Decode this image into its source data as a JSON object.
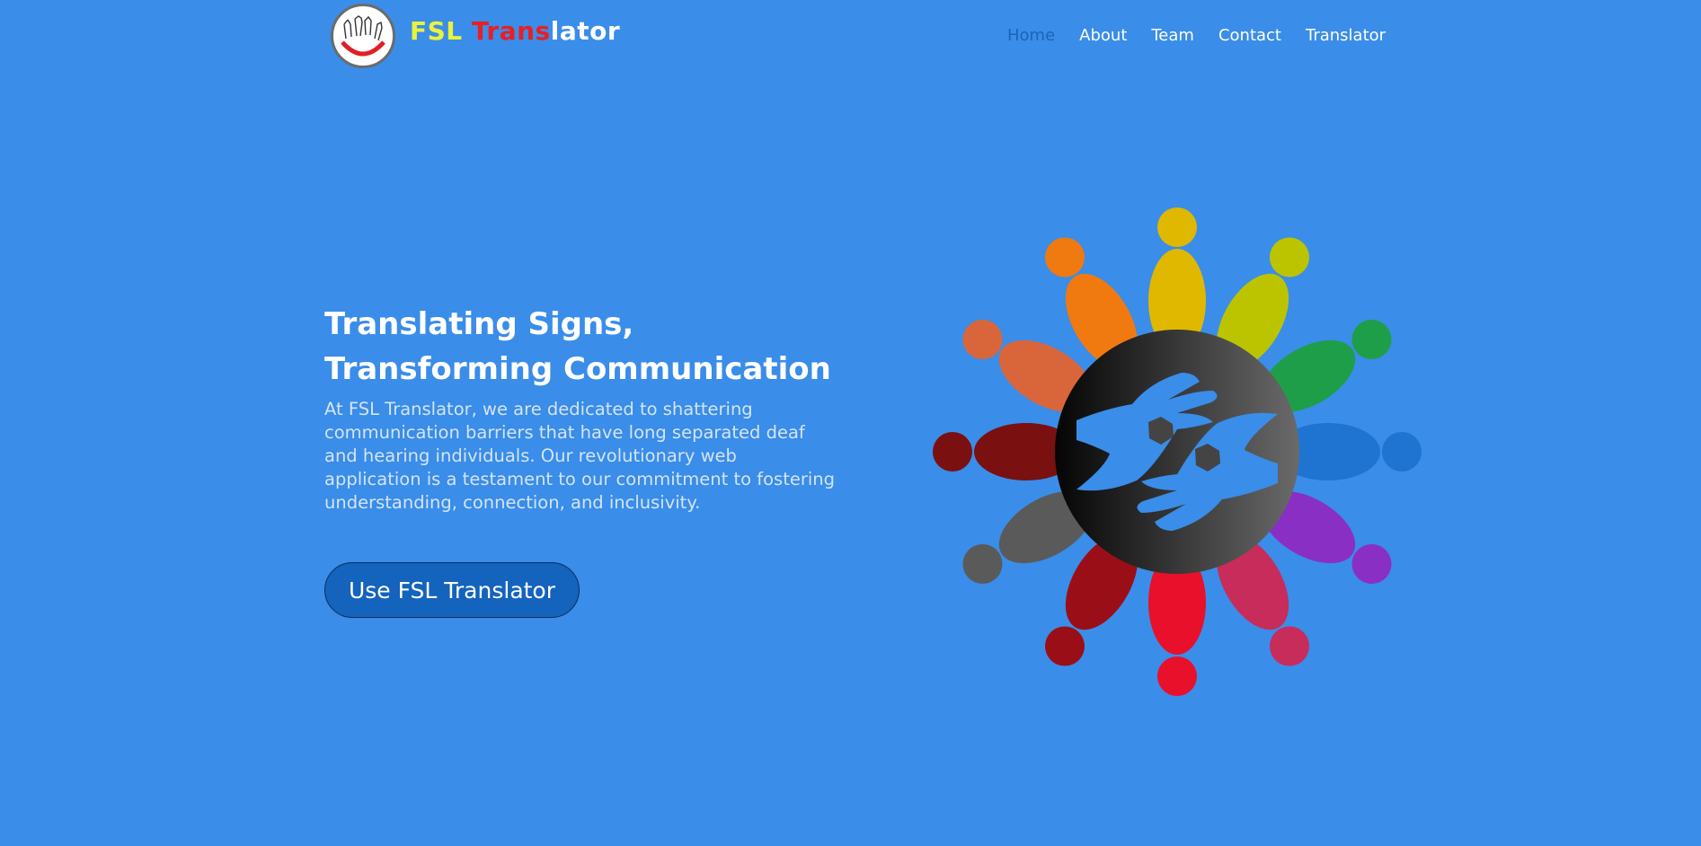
{
  "header": {
    "logo_icon": "hands-sign-logo",
    "brand": {
      "part1": "FSL ",
      "part2": "Trans",
      "part3": "lator"
    },
    "nav": [
      {
        "label": "Home",
        "active": true
      },
      {
        "label": "About",
        "active": false
      },
      {
        "label": "Team",
        "active": false
      },
      {
        "label": "Contact",
        "active": false
      },
      {
        "label": "Translator",
        "active": false
      }
    ]
  },
  "hero": {
    "title": "Translating Signs, Transforming Communication",
    "description": "At FSL Translator, we are dedicated to shattering communication barriers that have long separated deaf and hearing individuals. Our revolutionary web application is a testament to our commitment to fostering understanding, connection, and inclusivity.",
    "cta_label": "Use FSL Translator",
    "illustration_icon": "people-circle-sign-language-icon"
  },
  "colors": {
    "background": "#3a8de8",
    "nav_active": "#1c64b6",
    "cta_bg": "#1463bd",
    "brand_yellow": "#e9f23c",
    "brand_red": "#e81f23"
  }
}
